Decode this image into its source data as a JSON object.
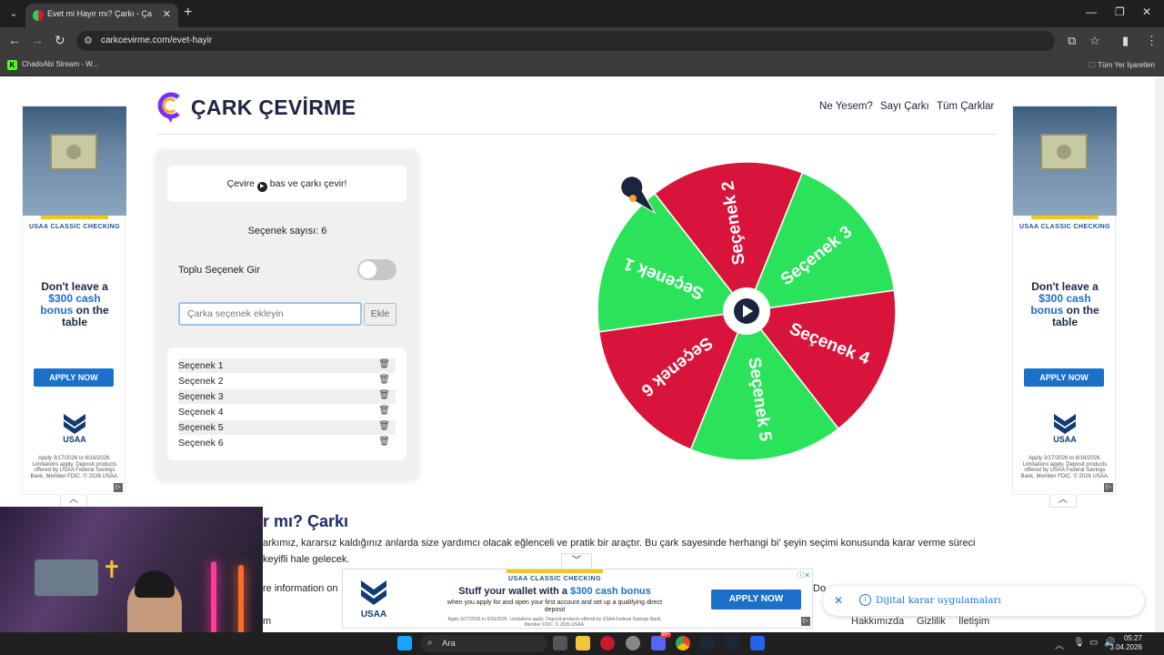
{
  "browser": {
    "tab_title": "Evet mi Hayır mı? Çarkı - Çark Çev",
    "url": "carkcevirme.com/evet-hayir",
    "bookmark": "ChadoAbi Stream - W...",
    "bookmark_icon": "K",
    "all_bookmarks": "Tüm Yer İşaretleri"
  },
  "site": {
    "logo_text": "ÇARK ÇEVİRME",
    "nav": [
      "Ne Yesem?",
      "Sayı Çarkı",
      "Tüm Çarklar"
    ]
  },
  "panel": {
    "hint_before": "Çevire",
    "hint_after": "bas ve çarkı çevir!",
    "count_label": "Seçenek sayısı: 6",
    "bulk_label": "Toplu Seçenek Gir",
    "bulk_enabled": false,
    "input_placeholder": "Çarka seçenek ekleyin",
    "add_label": "Ekle",
    "options": [
      "Seçenek 1",
      "Seçenek 2",
      "Seçenek 3",
      "Seçenek 4",
      "Seçenek 5",
      "Seçenek 6"
    ]
  },
  "wheel": {
    "segments": [
      {
        "label": "Seçenek 1",
        "color": "#2be35a"
      },
      {
        "label": "Seçenek 2",
        "color": "#d9143a"
      },
      {
        "label": "Seçenek 3",
        "color": "#2be35a"
      },
      {
        "label": "Seçenek 4",
        "color": "#d9143a"
      },
      {
        "label": "Seçenek 5",
        "color": "#2be35a"
      },
      {
        "label": "Seçenek 6",
        "color": "#d9143a"
      }
    ]
  },
  "content": {
    "heading": "r mı? Çarkı",
    "para1": "arkımız, kararsız kaldığınız anlarda size yardımcı olacak eğlenceli ve pratik bir araçtır. Bu çark sayesinde herhangi bi' şeyin seçimi konusunda karar verme süreci",
    "para2": "keyifli hale gelecek.",
    "para3": "re information on",
    "para3_right": "Do",
    "footer_left": "m",
    "footer_links": [
      "Hakkımızda",
      "Gizlilik",
      "İletişim"
    ]
  },
  "ads": {
    "side_head": "USAA CLASSIC CHECKING",
    "side_main_1": "Don't leave a",
    "side_main_hl": "$300 cash bonus",
    "side_main_2": "on the table",
    "side_btn": "APPLY NOW",
    "side_fine": "Apply 3/17/2026 to 6/16/2026. Limitations apply. Deposit products offered by USAA Federal Savings Bank, Member FDIC. © 2026 USAA.",
    "logo": "USAA",
    "bottom_head": "USAA CLASSIC CHECKING",
    "bottom_main_1": "Stuff your wallet with a",
    "bottom_main_hl": "$300 cash bonus",
    "bottom_sub": "when you apply for and open your first account and set up a qualifying direct deposit",
    "bottom_fine": "Apply 3/17/2026 to 6/16/2026. Limitations apply. Deposit products offered by USAA Federal Savings Bank, Member FDIC. © 2026 USAA.",
    "bottom_btn": "APPLY NOW"
  },
  "toast": {
    "text": "Dijital karar uygulamaları"
  },
  "taskbar": {
    "search": "Ara",
    "time": "05:27",
    "date": "3.04.2026",
    "mail_badge": "99+"
  }
}
